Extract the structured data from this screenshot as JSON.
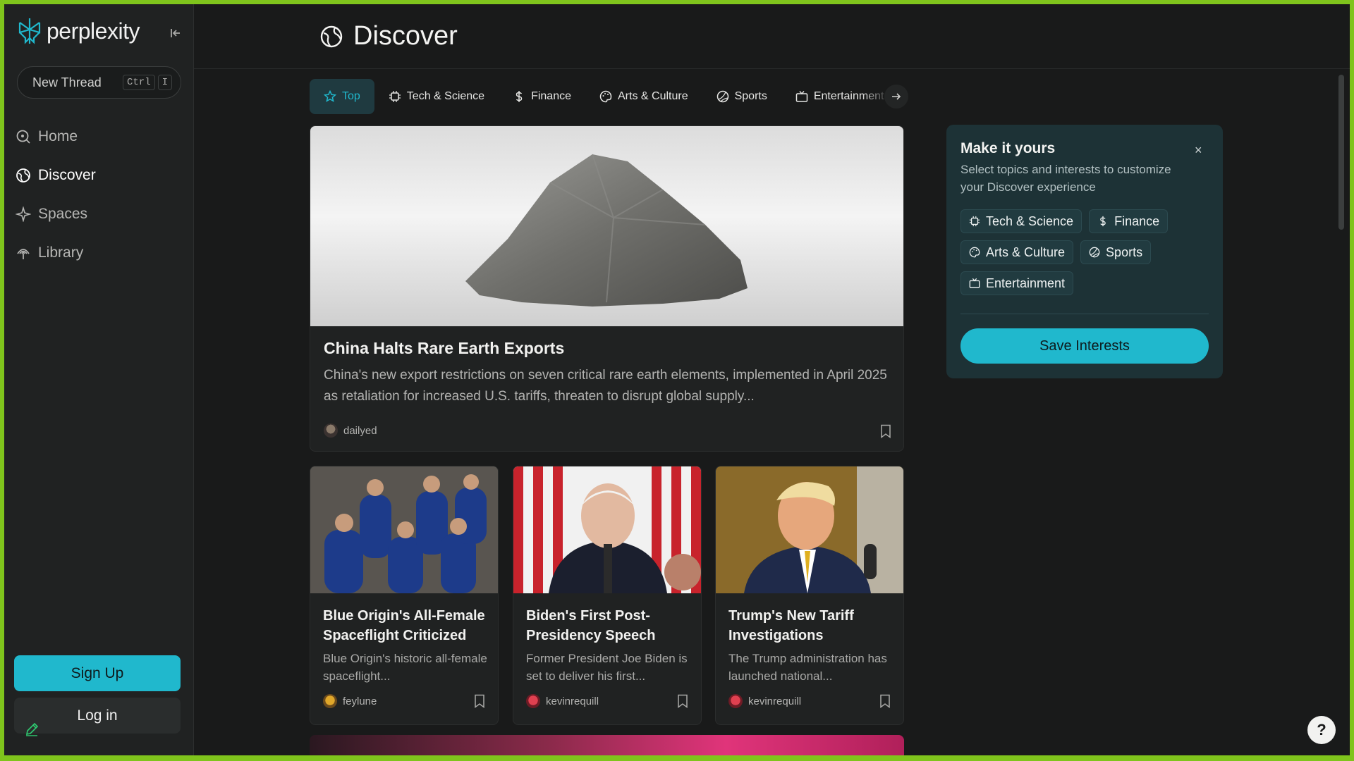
{
  "app": {
    "name": "perplexity"
  },
  "sidebar": {
    "new_thread": {
      "label": "New Thread",
      "kbd": [
        "Ctrl",
        "I"
      ]
    },
    "items": [
      {
        "label": "Home",
        "icon": "home-search-icon",
        "active": false
      },
      {
        "label": "Discover",
        "icon": "globe-icon",
        "active": true
      },
      {
        "label": "Spaces",
        "icon": "sparkle-icon",
        "active": false
      },
      {
        "label": "Library",
        "icon": "library-icon",
        "active": false
      }
    ],
    "signup_label": "Sign Up",
    "login_label": "Log in"
  },
  "header": {
    "title": "Discover"
  },
  "tabs": [
    {
      "label": "Top",
      "icon": "star-icon",
      "active": true
    },
    {
      "label": "Tech & Science",
      "icon": "chip-icon",
      "active": false
    },
    {
      "label": "Finance",
      "icon": "dollar-icon",
      "active": false
    },
    {
      "label": "Arts & Culture",
      "icon": "palette-icon",
      "active": false
    },
    {
      "label": "Sports",
      "icon": "ball-icon",
      "active": false
    },
    {
      "label": "Entertainment",
      "icon": "tv-icon",
      "active": false
    }
  ],
  "hero": {
    "title": "China Halts Rare Earth Exports",
    "description": "China's new export restrictions on seven critical rare earth elements, implemented in April 2025 as retaliation for increased U.S. tariffs, threaten to disrupt global supply...",
    "author": "dailyed"
  },
  "cards": [
    {
      "title": "Blue Origin's All-Female Spaceflight Criticized",
      "description": "Blue Origin's historic all-female spaceflight...",
      "author": "feylune"
    },
    {
      "title": "Biden's First Post-Presidency Speech",
      "description": "Former President Joe Biden is set to deliver his first...",
      "author": "kevinrequill"
    },
    {
      "title": "Trump's New Tariff Investigations",
      "description": "The Trump administration has launched national...",
      "author": "kevinrequill"
    }
  ],
  "interests": {
    "title": "Make it yours",
    "subtitle": "Select topics and interests to customize your Discover experience",
    "close": "×",
    "chips": [
      {
        "label": "Tech & Science",
        "icon": "chip-icon"
      },
      {
        "label": "Finance",
        "icon": "dollar-icon"
      },
      {
        "label": "Arts & Culture",
        "icon": "palette-icon"
      },
      {
        "label": "Sports",
        "icon": "ball-icon"
      },
      {
        "label": "Entertainment",
        "icon": "tv-icon"
      }
    ],
    "save_label": "Save Interests"
  },
  "help": {
    "label": "?"
  },
  "colors": {
    "accent": "#20b8cd",
    "background": "#191a1a",
    "sidebar": "#202222",
    "panel": "#1d3236"
  }
}
